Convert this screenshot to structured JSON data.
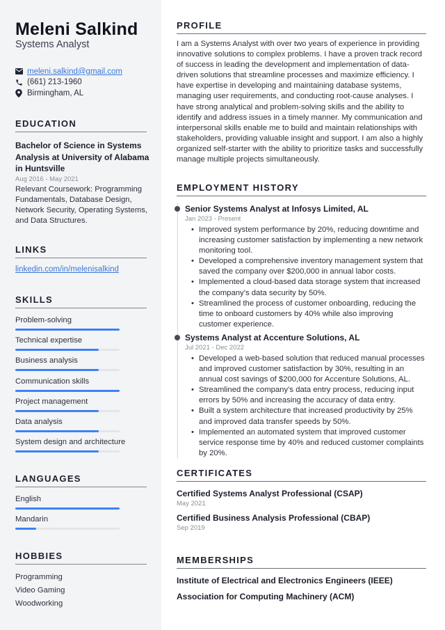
{
  "header": {
    "name": "Meleni Salkind",
    "role": "Systems Analyst"
  },
  "contact": {
    "email": "meleni.salkind@gmail.com",
    "phone": "(661) 213-1960",
    "location": "Birmingham, AL",
    "icons": [
      "envelope-icon",
      "phone-icon",
      "map-pin-icon"
    ]
  },
  "colors": {
    "accent": "#3b82f6",
    "link": "#3a78d8",
    "sidebar_bg": "#f3f4f6",
    "text": "#1f2433"
  },
  "sections": {
    "education": "EDUCATION",
    "links": "LINKS",
    "skills": "SKILLS",
    "languages": "LANGUAGES",
    "hobbies": "HOBBIES",
    "profile": "PROFILE",
    "employment": "EMPLOYMENT HISTORY",
    "certificates": "CERTIFICATES",
    "memberships": "MEMBERSHIPS"
  },
  "education": {
    "title": "Bachelor of Science in Systems Analysis at University of Alabama in Huntsville",
    "date": "Aug 2016 - May 2021",
    "description": "Relevant Coursework: Programming Fundamentals, Database Design, Network Security, Operating Systems, and Data Structures."
  },
  "links": {
    "linkedin": "linkedin.com/in/melenisalkind"
  },
  "skills": [
    {
      "label": "Problem-solving",
      "level_percent": 100
    },
    {
      "label": "Technical expertise",
      "level_percent": 80
    },
    {
      "label": "Business analysis",
      "level_percent": 80
    },
    {
      "label": "Communication skills",
      "level_percent": 100
    },
    {
      "label": "Project management",
      "level_percent": 80
    },
    {
      "label": "Data analysis",
      "level_percent": 80
    },
    {
      "label": "System design and architecture",
      "level_percent": 80
    }
  ],
  "languages": [
    {
      "label": "English",
      "level_percent": 100
    },
    {
      "label": "Mandarin",
      "level_percent": 20
    }
  ],
  "hobbies": [
    "Programming",
    "Video Gaming",
    "Woodworking"
  ],
  "profile": {
    "text": "I am a Systems Analyst with over two years of experience in providing innovative solutions to complex problems. I have a proven track record of success in leading the development and implementation of data-driven solutions that streamline processes and maximize efficiency. I have expertise in developing and maintaining database systems, managing user requirements, and conducting root-cause analyses. I have strong analytical and problem-solving skills and the ability to identify and address issues in a timely manner. My communication and interpersonal skills enable me to build and maintain relationships with stakeholders, providing valuable insight and support. I am also a highly organized self-starter with the ability to prioritize tasks and successfully manage multiple projects simultaneously."
  },
  "employment": [
    {
      "title": "Senior Systems Analyst at Infosys Limited, AL",
      "date": "Jan 2023 - Present",
      "bullets": [
        "Improved system performance by 20%, reducing downtime and increasing customer satisfaction by implementing a new network monitoring tool.",
        "Developed a comprehensive inventory management system that saved the company over $200,000 in annual labor costs.",
        "Implemented a cloud-based data storage system that increased the company’s data security by 50%.",
        "Streamlined the process of customer onboarding, reducing the time to onboard customers by 40% while also improving customer experience."
      ]
    },
    {
      "title": "Systems Analyst at Accenture Solutions, AL",
      "date": "Jul 2021 - Dec 2022",
      "bullets": [
        "Developed a web-based solution that reduced manual processes and improved customer satisfaction by 30%, resulting in an annual cost savings of $200,000 for Accenture Solutions, AL.",
        "Streamlined the company’s data entry process, reducing input errors by 50% and increasing the accuracy of data entry.",
        "Built a system architecture that increased productivity by 25% and improved data transfer speeds by 50%.",
        "Implemented an automated system that improved customer service response time by 40% and reduced customer complaints by 20%."
      ]
    }
  ],
  "certificates": [
    {
      "name": "Certified Systems Analyst Professional (CSAP)",
      "date": "May 2021"
    },
    {
      "name": "Certified Business Analysis Professional (CBAP)",
      "date": "Sep 2019"
    }
  ],
  "memberships": [
    "Institute of Electrical and Electronics Engineers (IEEE)",
    "Association for Computing Machinery (ACM)"
  ]
}
